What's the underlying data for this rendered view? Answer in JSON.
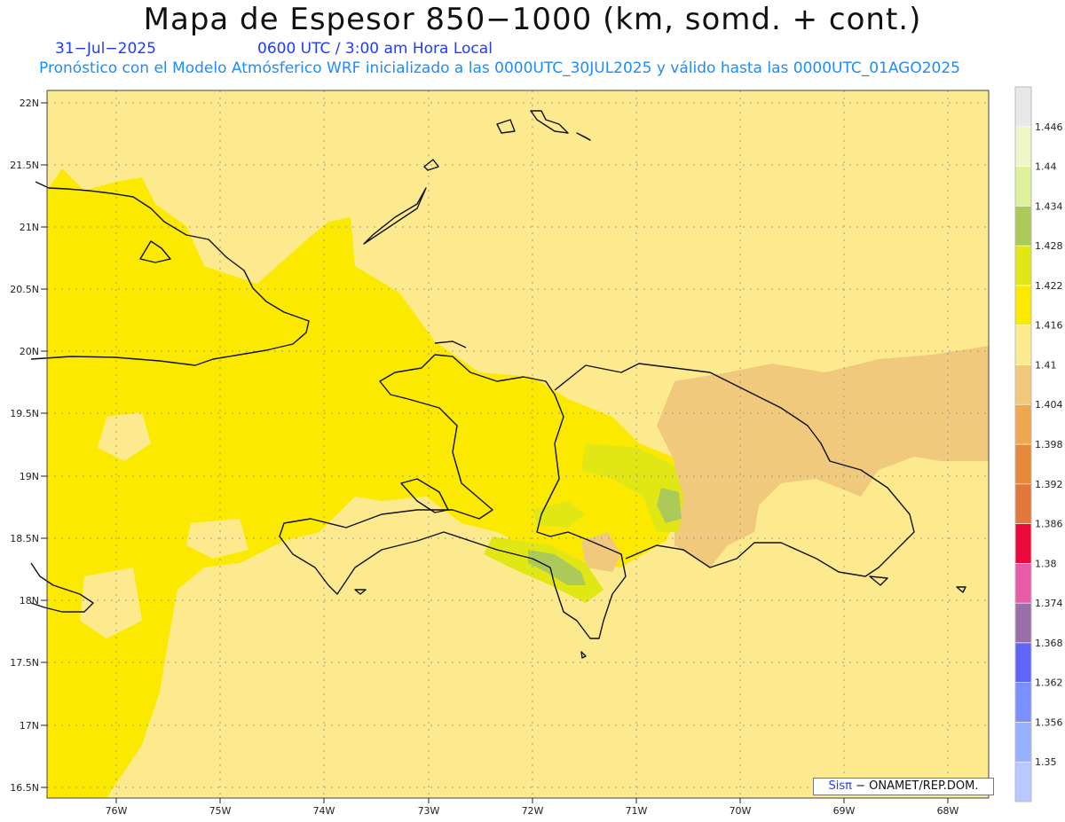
{
  "header": {
    "title": "Mapa de Espesor 850−1000 (km, somd. + cont.)",
    "date": "31−Jul−2025",
    "time": "0600 UTC / 3:00 am Hora Local",
    "model_line": "Pronóstico con el Modelo Atmósferico WRF inicializado a las 0000UTC_30JUL2025 y válido hasta las  0000UTC_01AGO2025"
  },
  "map": {
    "region": "Hispaniola / Cuba / Bahamas / Puerto Rico",
    "lon_range": [
      -76.65,
      -67.55
    ],
    "lat_range": [
      16.35,
      22.1
    ],
    "lat_ticks": [
      "22N",
      "21.5N",
      "21N",
      "20.5N",
      "20N",
      "19.5N",
      "19N",
      "18.5N",
      "18N",
      "17.5N",
      "17N",
      "16.5N"
    ],
    "lon_ticks": [
      "76W",
      "75W",
      "74W",
      "73W",
      "72W",
      "71W",
      "70W",
      "69W",
      "68W"
    ]
  },
  "legend": {
    "labels": [
      "1.35",
      "1.356",
      "1.362",
      "1.368",
      "1.374",
      "1.38",
      "1.386",
      "1.392",
      "1.398",
      "1.404",
      "1.41",
      "1.416",
      "1.422",
      "1.428",
      "1.434",
      "1.44",
      "1.446"
    ],
    "colors": [
      "#b9c9ff",
      "#96b2ff",
      "#7a90ff",
      "#5f66f7",
      "#9b6da9",
      "#e65ca8",
      "#ec0a3c",
      "#e1783a",
      "#e58a3a",
      "#eea84e",
      "#f0c97c",
      "#fdea8e",
      "#fbea00",
      "#e1e615",
      "#acca5a",
      "#dff09a",
      "#eef6c9",
      "#e8e8e8"
    ]
  },
  "credit": {
    "brand": "Sisπ",
    "text": " − ONAMET/REP.DOM."
  }
}
